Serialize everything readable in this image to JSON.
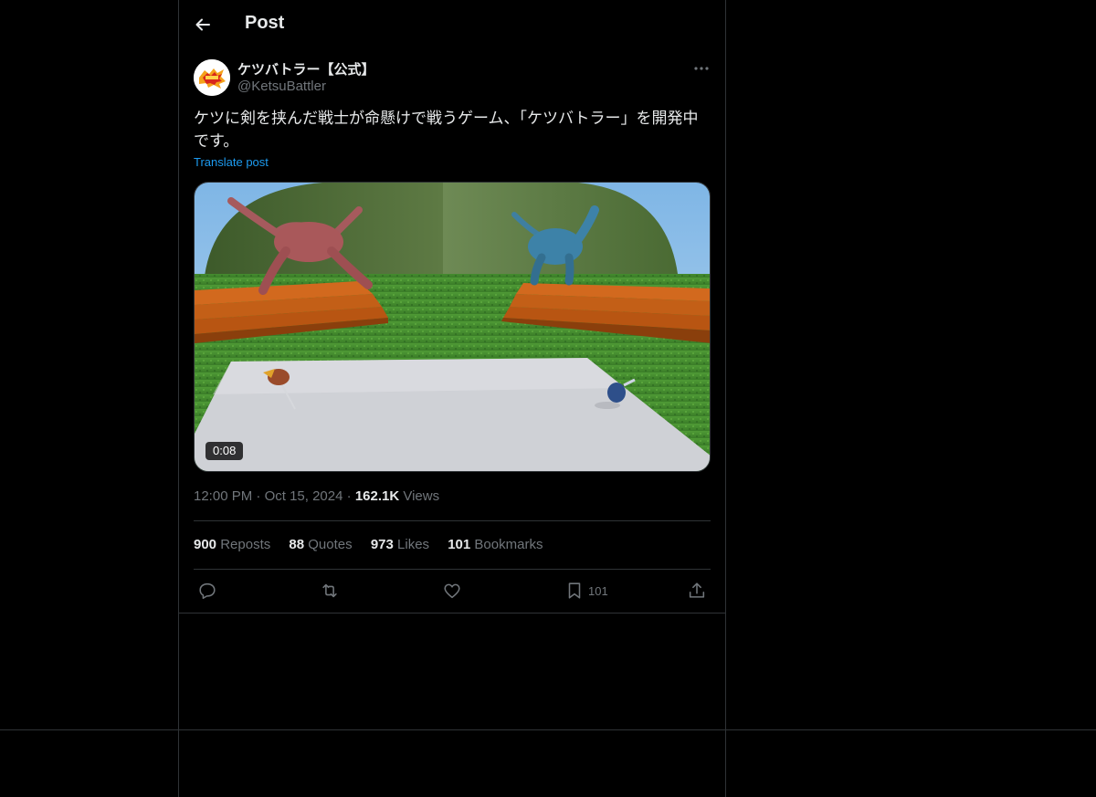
{
  "header": {
    "title": "Post"
  },
  "post": {
    "author_name": "ケツバトラー【公式】",
    "author_handle": "@KetsuBattler",
    "text": "ケツに剣を挟んだ戦士が命懸けで戦うゲーム、「ケツバトラー」を開発中です。",
    "translate_label": "Translate post",
    "video_duration": "0:08",
    "time": "12:00 PM",
    "date": "Oct 15, 2024",
    "views_count": "162.1K",
    "views_label": "Views",
    "dot": "·"
  },
  "stats": [
    {
      "count": "900",
      "label": "Reposts"
    },
    {
      "count": "88",
      "label": "Quotes"
    },
    {
      "count": "973",
      "label": "Likes"
    },
    {
      "count": "101",
      "label": "Bookmarks"
    }
  ],
  "actions": {
    "reply_icon": "reply-icon",
    "repost_icon": "repost-icon",
    "like_icon": "heart-icon",
    "bookmark_icon": "bookmark-icon",
    "bookmark_count": "101",
    "share_icon": "share-icon"
  },
  "colors": {
    "background": "#000000",
    "border": "#2f3336",
    "primary_text": "#e7e9ea",
    "secondary_text": "#71767b",
    "link": "#1d9bf0"
  }
}
